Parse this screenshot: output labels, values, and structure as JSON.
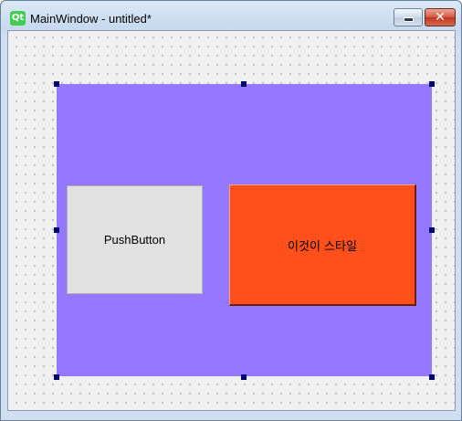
{
  "window": {
    "title": "MainWindow - untitled*",
    "app_logo_text": "Qt",
    "close_glyph": "✕"
  },
  "icons": {
    "app": "qt-logo-icon",
    "minimize": "minimize-icon",
    "close": "close-icon"
  },
  "form": {
    "central_widget_color": "#9478ff",
    "push_button": {
      "label": "PushButton"
    },
    "styled_button": {
      "label": "이것이 스타일",
      "color": "#ff4f1b"
    }
  },
  "colors": {
    "selection_handle": "#00006e",
    "canvas": "#f0f0f0"
  }
}
